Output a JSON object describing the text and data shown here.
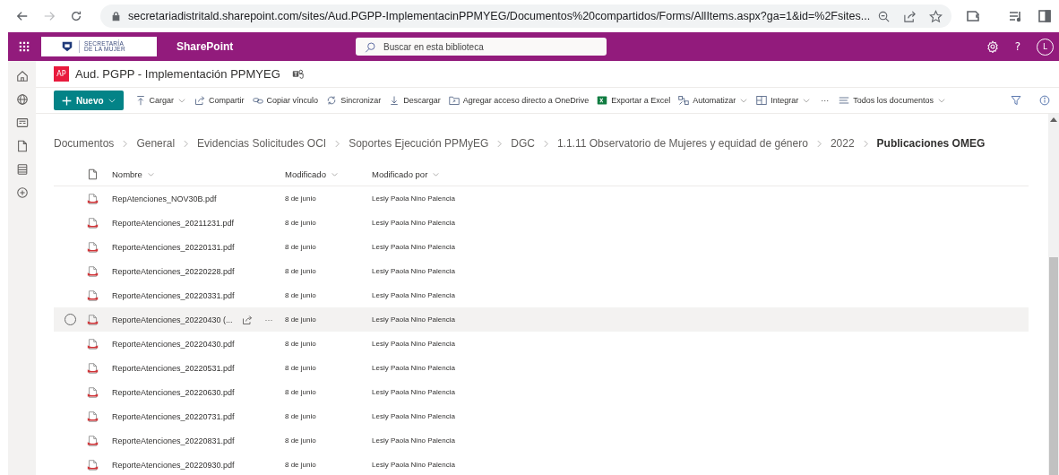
{
  "browser": {
    "url": "secretariadistritald.sharepoint.com/sites/Aud.PGPP-ImplementacinPPMYEG/Documentos%20compartidos/Forms/AllItems.aspx?ga=1&id=%2Fsites..."
  },
  "suite_bar": {
    "logo_lines": [
      "SECRETARÍA",
      "DE LA MUJER"
    ],
    "app_name": "SharePoint",
    "search": {
      "placeholder": "Buscar en esta biblioteca"
    },
    "help": "?",
    "avatar": "L"
  },
  "site": {
    "badge": "AP",
    "title": "Aud. PGPP - Implementación PPMYEG"
  },
  "command_bar": [
    {
      "kind": "primary",
      "label": "Nuevo",
      "dropdown": true
    },
    {
      "kind": "action",
      "label": "Cargar",
      "dropdown": true
    },
    {
      "kind": "action",
      "label": "Compartir",
      "dropdown": false
    },
    {
      "kind": "action",
      "label": "Copiar vínculo",
      "dropdown": false
    },
    {
      "kind": "action",
      "label": "Sincronizar",
      "dropdown": false
    },
    {
      "kind": "action",
      "label": "Descargar",
      "dropdown": false
    },
    {
      "kind": "action",
      "label": "Agregar acceso directo a OneDrive",
      "dropdown": false
    },
    {
      "kind": "action",
      "label": "Exportar a Excel",
      "dropdown": false
    },
    {
      "kind": "action",
      "label": "Automatizar",
      "dropdown": true
    },
    {
      "kind": "action",
      "label": "Integrar",
      "dropdown": true
    },
    {
      "kind": "more",
      "label": "···",
      "dropdown": false
    },
    {
      "kind": "view",
      "label": "Todos los documentos",
      "dropdown": true
    }
  ],
  "breadcrumb": [
    {
      "label": "Documentos",
      "current": false
    },
    {
      "label": "General",
      "current": false
    },
    {
      "label": "Evidencias Solicitudes OCI",
      "current": false
    },
    {
      "label": "Soportes Ejecución PPMyEG",
      "current": false
    },
    {
      "label": "DGC",
      "current": false
    },
    {
      "label": "1.1.11 Observatorio de Mujeres y equidad de género",
      "current": false
    },
    {
      "label": "2022",
      "current": false
    },
    {
      "label": "Publicaciones OMEG",
      "current": true
    }
  ],
  "table": {
    "columns": [
      "Nombre",
      "Modificado",
      "Modificado por"
    ],
    "rows": [
      {
        "name": "RepAtenciones_NOV30B.pdf",
        "modified": "8 de junio",
        "modified_by": "Lesly Paola Nino Palencia",
        "highlighted": false
      },
      {
        "name": "ReporteAtenciones_20211231.pdf",
        "modified": "8 de junio",
        "modified_by": "Lesly Paola Nino Palencia",
        "highlighted": false
      },
      {
        "name": "ReporteAtenciones_20220131.pdf",
        "modified": "8 de junio",
        "modified_by": "Lesly Paola Nino Palencia",
        "highlighted": false
      },
      {
        "name": "ReporteAtenciones_20220228.pdf",
        "modified": "8 de junio",
        "modified_by": "Lesly Paola Nino Palencia",
        "highlighted": false
      },
      {
        "name": "ReporteAtenciones_20220331.pdf",
        "modified": "8 de junio",
        "modified_by": "Lesly Paola Nino Palencia",
        "highlighted": false
      },
      {
        "name": "ReporteAtenciones_20220430 (...",
        "modified": "8 de junio",
        "modified_by": "Lesly Paola Nino Palencia",
        "highlighted": true,
        "more": "···"
      },
      {
        "name": "ReporteAtenciones_20220430.pdf",
        "modified": "8 de junio",
        "modified_by": "Lesly Paola Nino Palencia",
        "highlighted": false
      },
      {
        "name": "ReporteAtenciones_20220531.pdf",
        "modified": "8 de junio",
        "modified_by": "Lesly Paola Nino Palencia",
        "highlighted": false
      },
      {
        "name": "ReporteAtenciones_20220630.pdf",
        "modified": "8 de junio",
        "modified_by": "Lesly Paola Nino Palencia",
        "highlighted": false
      },
      {
        "name": "ReporteAtenciones_20220731.pdf",
        "modified": "8 de junio",
        "modified_by": "Lesly Paola Nino Palencia",
        "highlighted": false
      },
      {
        "name": "ReporteAtenciones_20220831.pdf",
        "modified": "8 de junio",
        "modified_by": "Lesly Paola Nino Palencia",
        "highlighted": false
      },
      {
        "name": "ReporteAtenciones_20220930.pdf",
        "modified": "8 de junio",
        "modified_by": "Lesly Paola Nino Palencia",
        "highlighted": false
      }
    ]
  }
}
